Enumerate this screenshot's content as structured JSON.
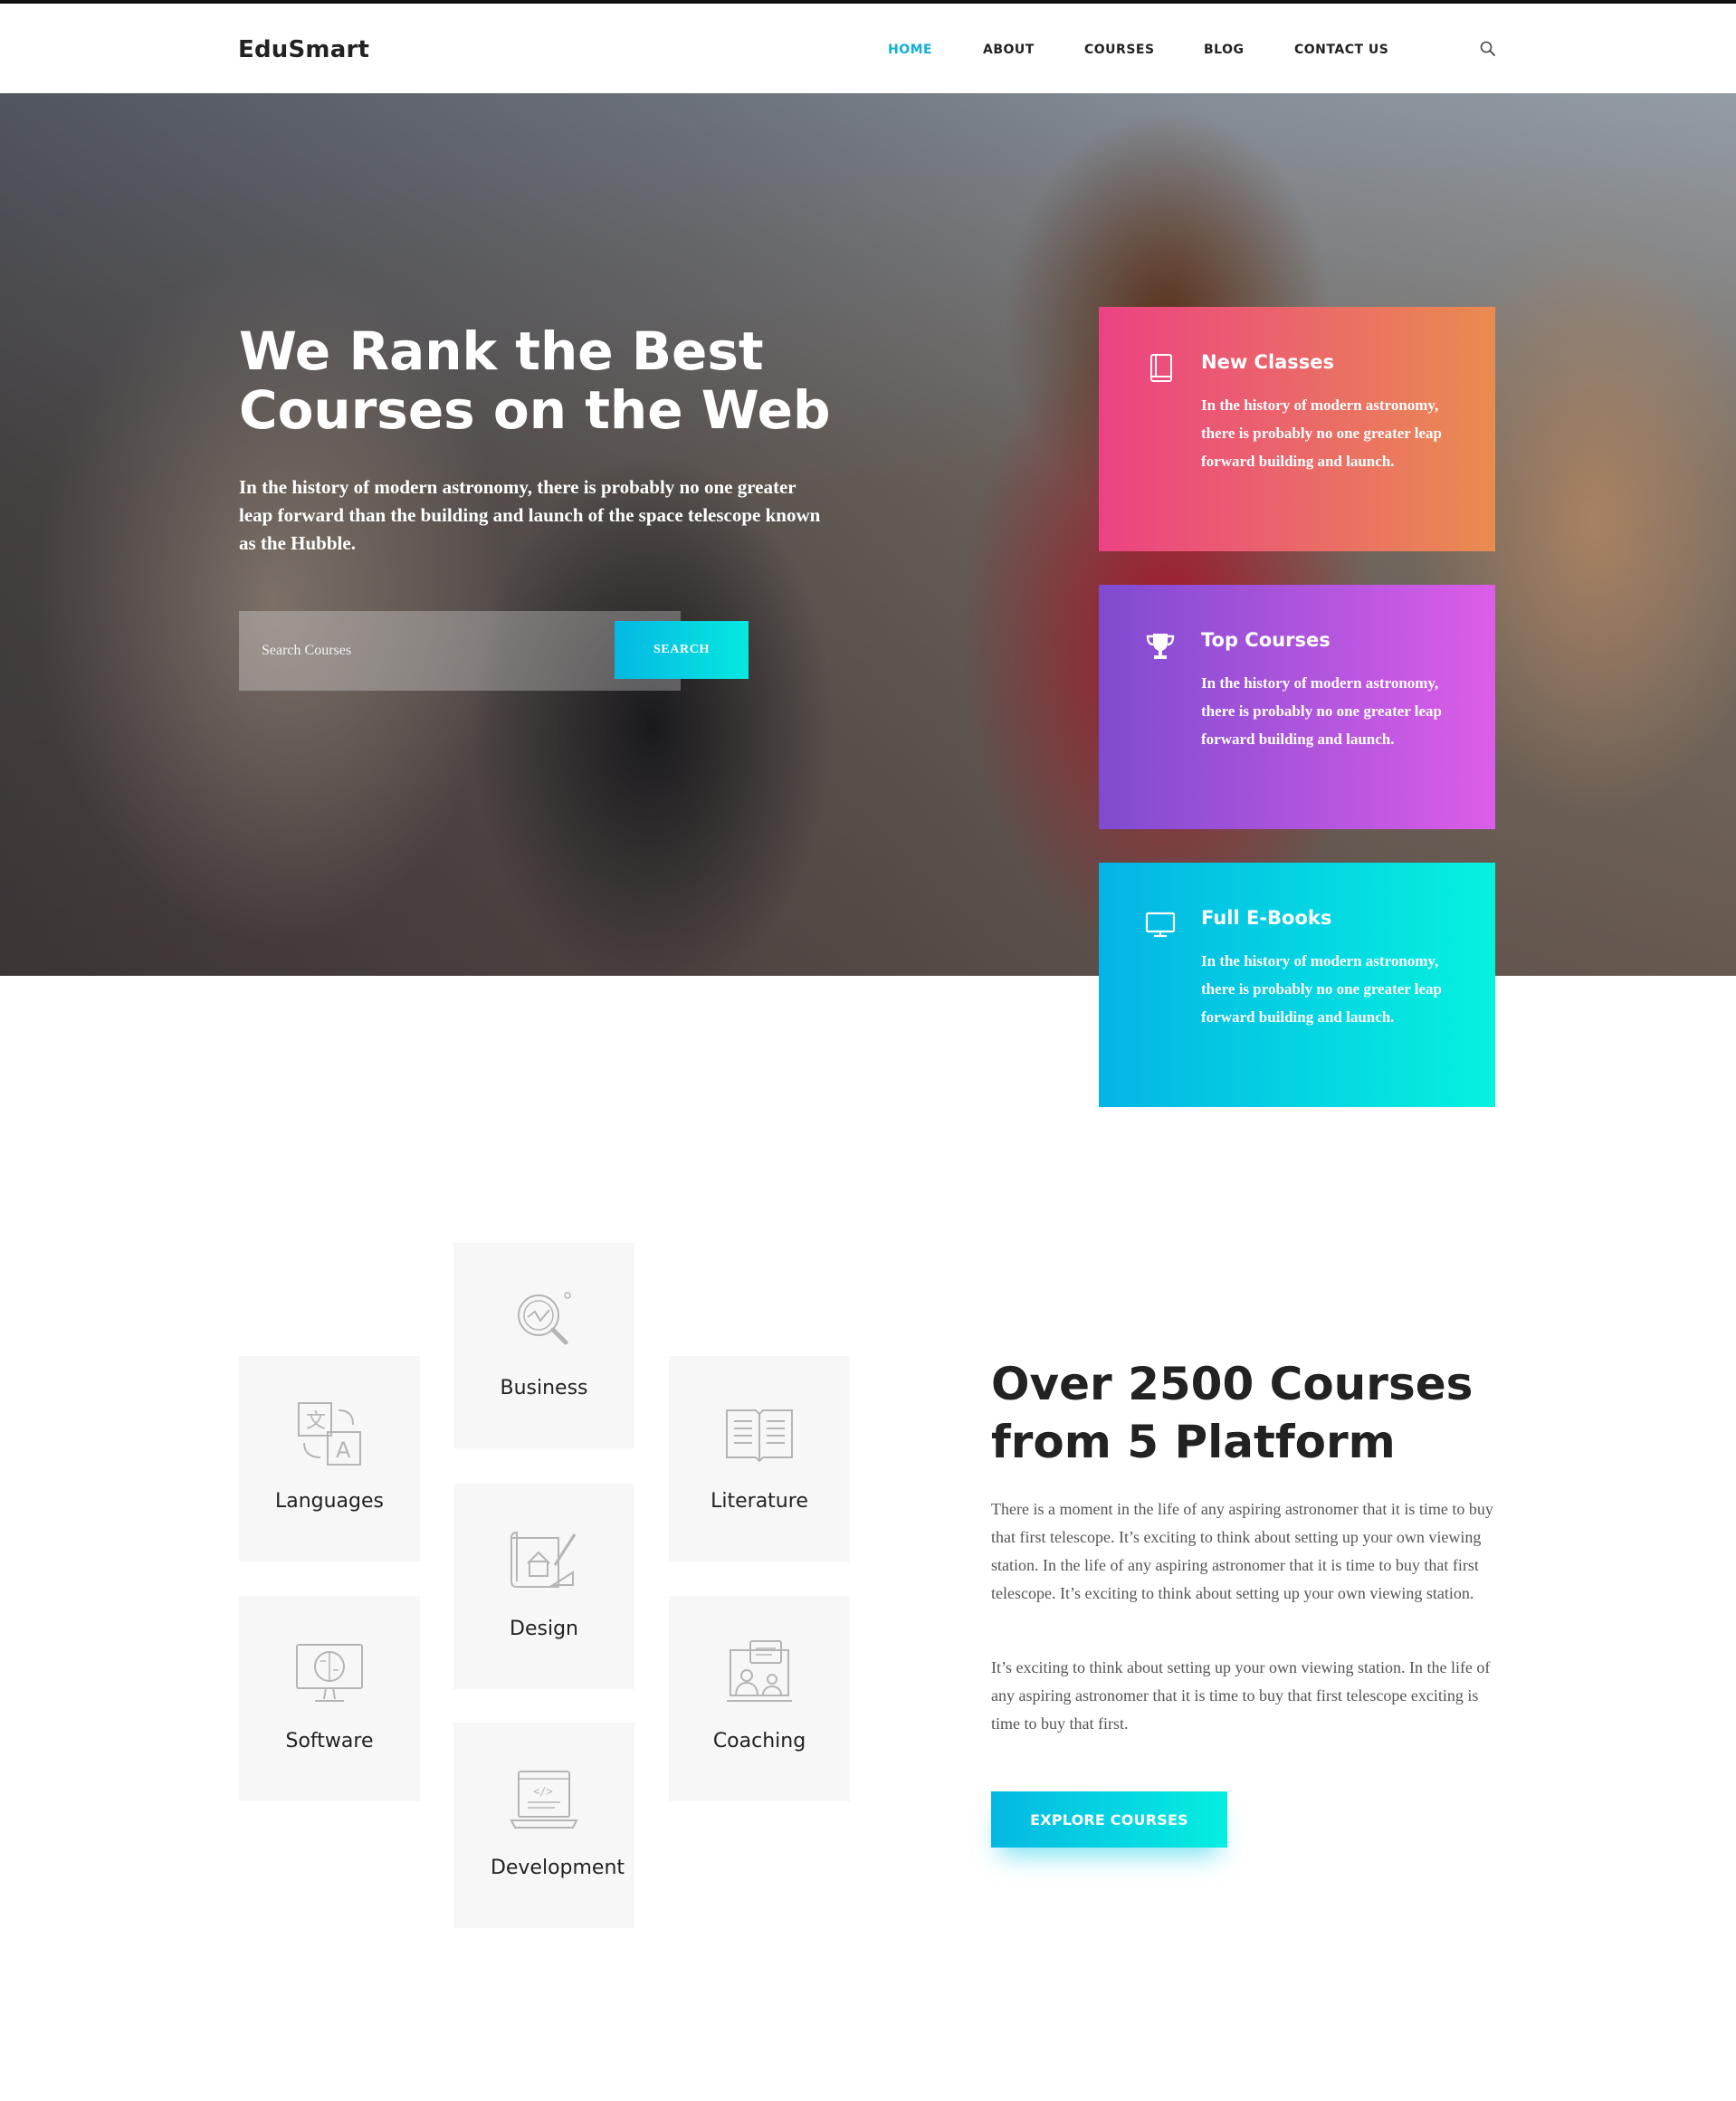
{
  "header": {
    "logo": "EduSmart",
    "nav": [
      {
        "label": "HOME",
        "active": true
      },
      {
        "label": "ABOUT",
        "active": false
      },
      {
        "label": "COURSES",
        "active": false
      },
      {
        "label": "BLOG",
        "active": false
      },
      {
        "label": "CONTACT US",
        "active": false
      }
    ],
    "search_icon": "search-icon"
  },
  "hero": {
    "title": "We Rank the Best Courses on the Web",
    "text": "In the history of modern astronomy, there is probably no one greater leap forward than the building and launch of the space telescope known as the Hubble.",
    "search_placeholder": "Search Courses",
    "search_button": "SEARCH"
  },
  "features": [
    {
      "icon": "book-icon",
      "title": "New Classes",
      "text": "In the history of modern astronomy, there is probably no one greater leap forward building and launch.",
      "colors": [
        "#ec4283",
        "#e98c50"
      ]
    },
    {
      "icon": "trophy-icon",
      "title": "Top Courses",
      "text": "In the history of modern astronomy, there is probably no one greater leap forward building and launch.",
      "colors": [
        "#7e4bd0",
        "#dc5de8"
      ]
    },
    {
      "icon": "monitor-icon",
      "title": "Full E-Books",
      "text": "In the history of modern astronomy, there is probably no one greater leap forward building and launch.",
      "colors": [
        "#04b4e5",
        "#05f2df"
      ]
    }
  ],
  "categories": [
    {
      "label": "Business",
      "icon": "analytics-magnifier-icon"
    },
    {
      "label": "Languages",
      "icon": "translate-icon"
    },
    {
      "label": "Literature",
      "icon": "open-book-icon"
    },
    {
      "label": "Design",
      "icon": "blueprint-icon"
    },
    {
      "label": "Software",
      "icon": "chip-monitor-icon"
    },
    {
      "label": "Coaching",
      "icon": "presentation-icon"
    },
    {
      "label": "Development",
      "icon": "code-laptop-icon"
    }
  ],
  "courses_section": {
    "title": "Over 2500 Courses from 5 Platform",
    "paragraph1": "There is a moment in the life of any aspiring astronomer that it is time to buy that first telescope. It’s exciting to think about setting up your own viewing station. In the life of any aspiring astronomer that it is time to buy that first telescope. It’s exciting to think about setting up your own viewing station.",
    "paragraph2": "It’s exciting to think about setting up your own viewing station. In the life of any aspiring astronomer that it is time to buy that first telescope exciting is time to buy that first.",
    "button": "EXPLORE COURSES"
  },
  "colors": {
    "accent": "#0fb1d6",
    "text_dark": "#222222",
    "tile_bg": "#f7f7f7"
  }
}
